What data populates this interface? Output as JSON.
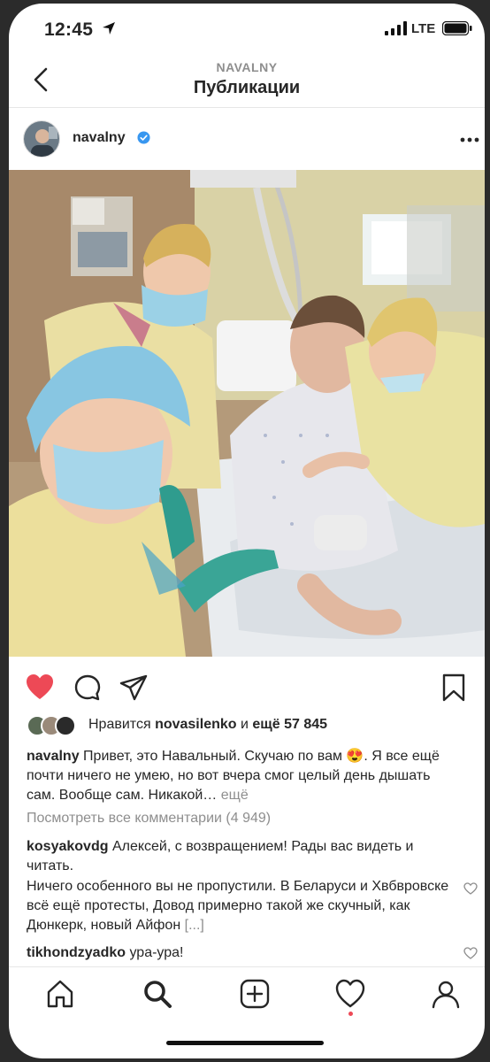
{
  "status_bar": {
    "time": "12:45",
    "network": "LTE"
  },
  "header": {
    "subtitle": "NAVALNY",
    "title": "Публикации"
  },
  "post": {
    "username": "navalny",
    "likes": {
      "prefix": "Нравится",
      "user": "novasilenko",
      "middle": "и",
      "rest": "ещё 57 845"
    },
    "caption": {
      "username": "navalny",
      "text": "Привет, это Навальный. Скучаю по вам 😍. Я все ещё почти ничего не умею, но вот вчера смог целый день дышать сам. Вообще сам. Никакой…",
      "more": "ещё"
    },
    "view_all_comments": "Посмотреть все комментарии (4 949)",
    "comments": [
      {
        "username": "kosyakovdg",
        "text": "Алексей, с возвращением! Рады вас видеть и читать."
      },
      {
        "username": "",
        "text": "Ничего особенного вы не пропустили. В Беларуси и Хвбвровске всё ещё протесты, Довод примерно такой же скучный, как Дюнкерк, новый Айфон",
        "more": "[...]"
      },
      {
        "username": "tikhondzyadko",
        "text": "ура-ура!"
      }
    ]
  },
  "colors": {
    "like": "#ed4956",
    "verified": "#3897f0",
    "muted": "#8e8e8e"
  },
  "icons": {
    "back": "chevron-left-icon",
    "more": "more-options-icon",
    "like": "heart-filled-icon",
    "comment": "comment-icon",
    "share": "send-icon",
    "save": "bookmark-icon",
    "home": "home-icon",
    "search": "search-icon",
    "add": "add-post-icon",
    "activity": "heart-outline-icon",
    "profile": "profile-icon"
  }
}
